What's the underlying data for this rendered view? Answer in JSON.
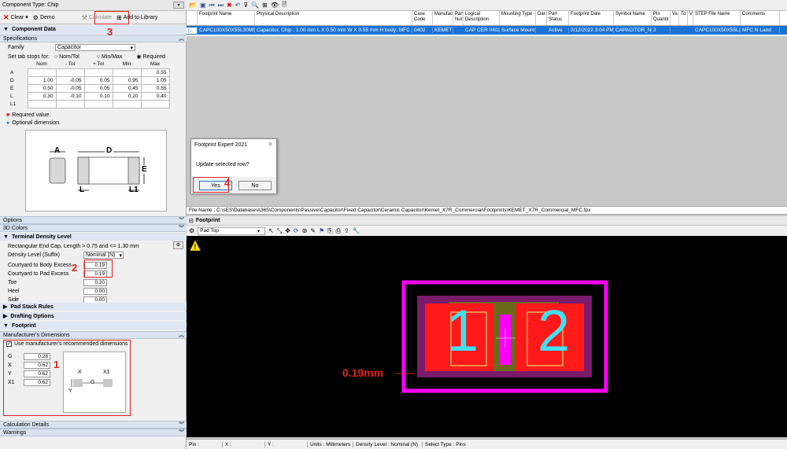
{
  "left": {
    "component_type": "Component Type: Chip",
    "toolbar": {
      "clear": "Clear",
      "demo": "Demo",
      "calculate": "Calculate",
      "add_library": "Add to Library"
    },
    "component_data": "Component Data",
    "specifications": "Specifications",
    "family_label": "Family",
    "family_value": "Capacitor",
    "tab_stops_label": "Set tab stops for:",
    "tab_opts": [
      "Nom/Tol",
      "Min/Max",
      "Required"
    ],
    "dim_headers": [
      "Nom",
      "- Tol",
      "+ Tol",
      "Min",
      "Max"
    ],
    "dims": [
      {
        "name": "A",
        "nom": "",
        "mtol": "",
        "ptol": "",
        "min": "",
        "max": "0.55"
      },
      {
        "name": "D",
        "nom": "1.00",
        "mtol": "-0.05",
        "ptol": "0.05",
        "min": "0.95",
        "max": "1.05"
      },
      {
        "name": "E",
        "nom": "0.50",
        "mtol": "-0.05",
        "ptol": "0.05",
        "min": "0.45",
        "max": "0.55"
      },
      {
        "name": "L",
        "nom": "0.30",
        "mtol": "-0.10",
        "ptol": "0.10",
        "min": "0.20",
        "max": "0.40"
      },
      {
        "name": "L1",
        "nom": "",
        "mtol": "",
        "ptol": "",
        "min": "",
        "max": ""
      }
    ],
    "required_note": "Required value.",
    "optional_note": "Optional dimension.",
    "diagram_labels": {
      "a": "A",
      "d": "D",
      "e": "E",
      "l": "L",
      "l1": "L1"
    },
    "options": "Options",
    "colors_3d": "3D Colors",
    "terminal_density": "Terminal Density Level",
    "density_desc": "Rectangular End Cap, Length > 0.75 and <= 1.30 mm",
    "density_label": "Density Level (Suffix)",
    "density_value": "Nominal (N)",
    "excess_fields": [
      {
        "label": "Courtyard to Body Excess",
        "value": "0.19"
      },
      {
        "label": "Courtyard to Pad Excess",
        "value": "0.19"
      },
      {
        "label": "Toe",
        "value": "0.20"
      },
      {
        "label": "Heel",
        "value": "0.00"
      },
      {
        "label": "Side",
        "value": "0.00"
      }
    ],
    "pad_stack": "Pad Stack Rules",
    "drafting": "Drafting Options",
    "footprint": "Footprint",
    "mfr_dims": "Manufacturer's Dimensions",
    "use_mfr": "Use manufacturer's recommended dimensions",
    "mfr_fields": [
      {
        "label": "G",
        "value": "0.28"
      },
      {
        "label": "X",
        "value": "0.62"
      },
      {
        "label": "Y",
        "value": "0.62"
      },
      {
        "label": "X1",
        "value": "0.62"
      }
    ],
    "pad_diagram": {
      "x": "X",
      "x1": "X1",
      "g": "G",
      "y": "Y"
    },
    "calc_details": "Calculation Details",
    "warnings": "Warnings"
  },
  "annotations": {
    "n1": "1",
    "n2": "2",
    "n3": "3",
    "n4": "4",
    "dim": "0.19mm"
  },
  "grid": {
    "headers": [
      "Footprint Name",
      "Physical Description",
      "Case Code",
      "Manufac",
      "Part Nun",
      "Logical Description",
      "Mounting Type",
      "Dat",
      "Part Status",
      "Footprint Date",
      "Symbol Name",
      "Pin Quantit",
      "Va",
      "To",
      "V",
      "STEP File Name",
      "Comments"
    ],
    "row": [
      "CAPC100X50X55L30MN",
      "Capacitor, Chip ; 1.00 mm L X 0.50 mm W X 0.55 mm H body; MFC N Land",
      "0402",
      "KEMET",
      "",
      "CAP CER 0402",
      "Surface Mount",
      "",
      "Active",
      "2/12/2022 3:04 PM",
      "CAPACITOR_NP",
      "2",
      "",
      "",
      "",
      "CAPC100X50X55L30",
      "MFC N Land"
    ]
  },
  "dialog": {
    "title": "Footprint Expert 2021",
    "message": "Update selected row?",
    "yes": "Yes",
    "no": "No"
  },
  "file_name": "File Name :   C:\\sES\\Database\\A365\\Components\\Passive\\Capacitor\\Fixed Capacitor\\Ceramic Capacitor\\Kemet_X7R_Commercial\\Footprints\\KEMET_X7R_Commercial_MFC.fpx",
  "footprint_title": "Footprint",
  "layer_select": "Pad Top",
  "pads": {
    "p1": "1",
    "p2": "2"
  },
  "status": {
    "pin": "Pin :",
    "x": "X :",
    "y": "Y :",
    "units": "Units : Millimeters",
    "density": "Density Level : Nominal (N)",
    "select": "Select Type : Pins"
  },
  "colors": {
    "accent": "#1a73d6",
    "annot": "#e02020",
    "courtyard": "#ff00ff",
    "pad": "#ff1a1a",
    "silk": "#40e0f0"
  }
}
